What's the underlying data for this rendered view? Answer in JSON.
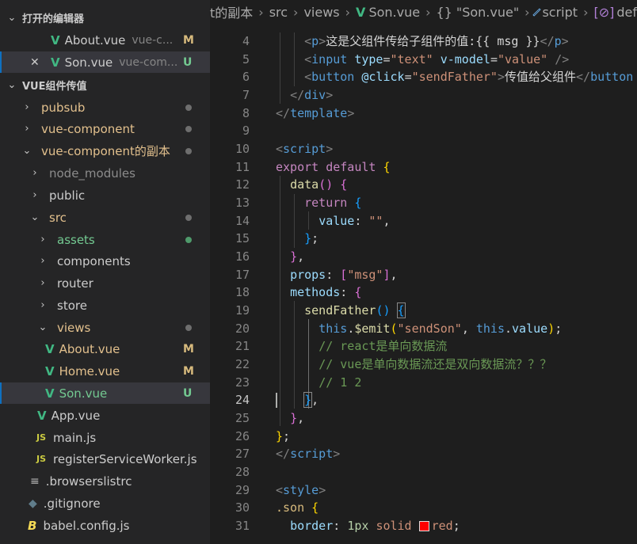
{
  "explorer": {
    "open_editors_title": "打开的编辑器",
    "open_editors": [
      {
        "name": "About.vue",
        "path": "vue-c...",
        "status": "M"
      },
      {
        "name": "Son.vue",
        "path": "vue-com...",
        "status": "U"
      }
    ],
    "project_title": "VUE组件传值",
    "tree": [
      {
        "label": "pubsub"
      },
      {
        "label": "vue-component"
      },
      {
        "label": "vue-component的副本"
      },
      {
        "label": "node_modules"
      },
      {
        "label": "public"
      },
      {
        "label": "src"
      },
      {
        "label": "assets"
      },
      {
        "label": "components"
      },
      {
        "label": "router"
      },
      {
        "label": "store"
      },
      {
        "label": "views"
      },
      {
        "label": "About.vue",
        "status": "M"
      },
      {
        "label": "Home.vue",
        "status": "M"
      },
      {
        "label": "Son.vue",
        "status": "U"
      },
      {
        "label": "App.vue"
      },
      {
        "label": "main.js",
        "icon": "JS"
      },
      {
        "label": "registerServiceWorker.js",
        "icon": "JS"
      },
      {
        "label": ".browserslistrc"
      },
      {
        "label": ".gitignore"
      },
      {
        "label": "babel.config.js"
      }
    ]
  },
  "breadcrumb": {
    "folder": "t的副本",
    "src": "src",
    "views": "views",
    "file": "Son.vue",
    "block_icon": "{}",
    "block": "\"Son.vue\"",
    "script": "script",
    "last": "def"
  },
  "line_numbers": [
    "4",
    "5",
    "6",
    "7",
    "8",
    "9",
    "10",
    "11",
    "12",
    "13",
    "14",
    "15",
    "16",
    "17",
    "18",
    "19",
    "20",
    "21",
    "22",
    "23",
    "24",
    "25",
    "26",
    "27",
    "28",
    "29",
    "30",
    "31"
  ],
  "code": {
    "l4_text": "这是父组件传给子组件的值:",
    "l4_msg": " msg ",
    "l5_attr1": "type",
    "l5_val1": "\"text\"",
    "l5_attr2": "v-model",
    "l5_val2": "\"value\"",
    "l6_attr": "@click",
    "l6_val": "\"sendFather\"",
    "l6_text": "传值给父组件",
    "l11_export": "export default",
    "l12_data": "data",
    "l13_return": "return",
    "l14_key": "value",
    "l14_val": "\"\"",
    "l17_props": "props",
    "l17_val": "\"msg\"",
    "l18_methods": "methods",
    "l19_fn": "sendFather",
    "l20_this": "this",
    "l20_emit": "$emit",
    "l20_arg": "\"sendSon\"",
    "l20_value": "value",
    "l21_comment": "// react是单向数据流",
    "l22_comment": "// vue是单向数据流还是双向数据流？？？",
    "l23_comment": "// 1 2",
    "l30_sel": ".son",
    "l31_prop": "border",
    "l31_num": "1px",
    "l31_style": "solid",
    "l31_color": "red"
  },
  "colors": {
    "vue": "#41b883",
    "modified": "#d7ba7d",
    "untracked": "#73c991",
    "selection": "#37373d"
  }
}
